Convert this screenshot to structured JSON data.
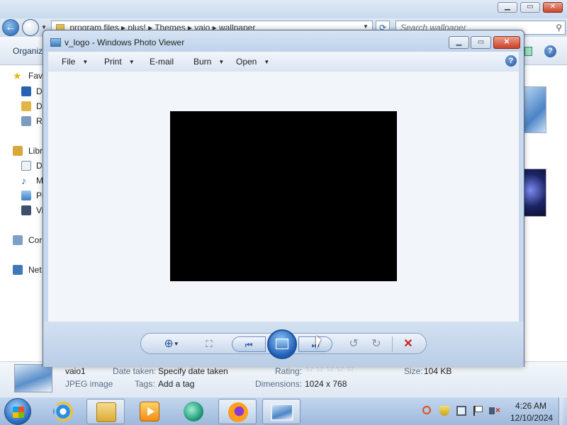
{
  "explorer": {
    "address_path": "program files  ▸  plus!  ▸  Themes  ▸  vaio  ▸  wallpaper",
    "search_placeholder": "Search wallpaper",
    "toolbar": {
      "organize_label": "Organiz"
    },
    "nav_items": [
      "Fav",
      "D",
      "D",
      "Re",
      "Libr",
      "D",
      "M",
      "Pi",
      "Vi",
      "Cor",
      "Net"
    ],
    "details": {
      "file_name": "vaio1",
      "file_type": "JPEG image",
      "date_taken_label": "Date taken:",
      "date_taken_value": "Specify date taken",
      "tags_label": "Tags:",
      "tags_value": "Add a tag",
      "rating_label": "Rating:",
      "dimensions_label": "Dimensions:",
      "dimensions_value": "1024 x 768",
      "size_label": "Size:",
      "size_value": "104 KB"
    }
  },
  "viewer": {
    "title": "v_logo - Windows Photo Viewer",
    "menu": {
      "file": "File",
      "print": "Print",
      "email": "E-mail",
      "burn": "Burn",
      "open": "Open"
    },
    "photo_color": "#000000"
  },
  "taskbar": {
    "clock_time": "4:26 AM",
    "clock_date": "12/10/2024"
  },
  "icons": [
    "back-arrow-icon",
    "forward-arrow-icon",
    "refresh-icon",
    "search-icon",
    "help-icon",
    "zoom-icon",
    "actual-size-icon",
    "previous-icon",
    "slideshow-icon",
    "next-icon",
    "rotate-left-icon",
    "rotate-right-icon",
    "delete-icon",
    "windows-start-icon",
    "internet-explorer-icon",
    "file-explorer-icon",
    "media-player-icon",
    "firefox-icon",
    "photo-viewer-icon"
  ],
  "colors": {
    "window_frame": "#c8d9ee",
    "canvas": "#f2f6fb",
    "close_button": "#c8412a",
    "delete_icon": "#c8211a"
  }
}
